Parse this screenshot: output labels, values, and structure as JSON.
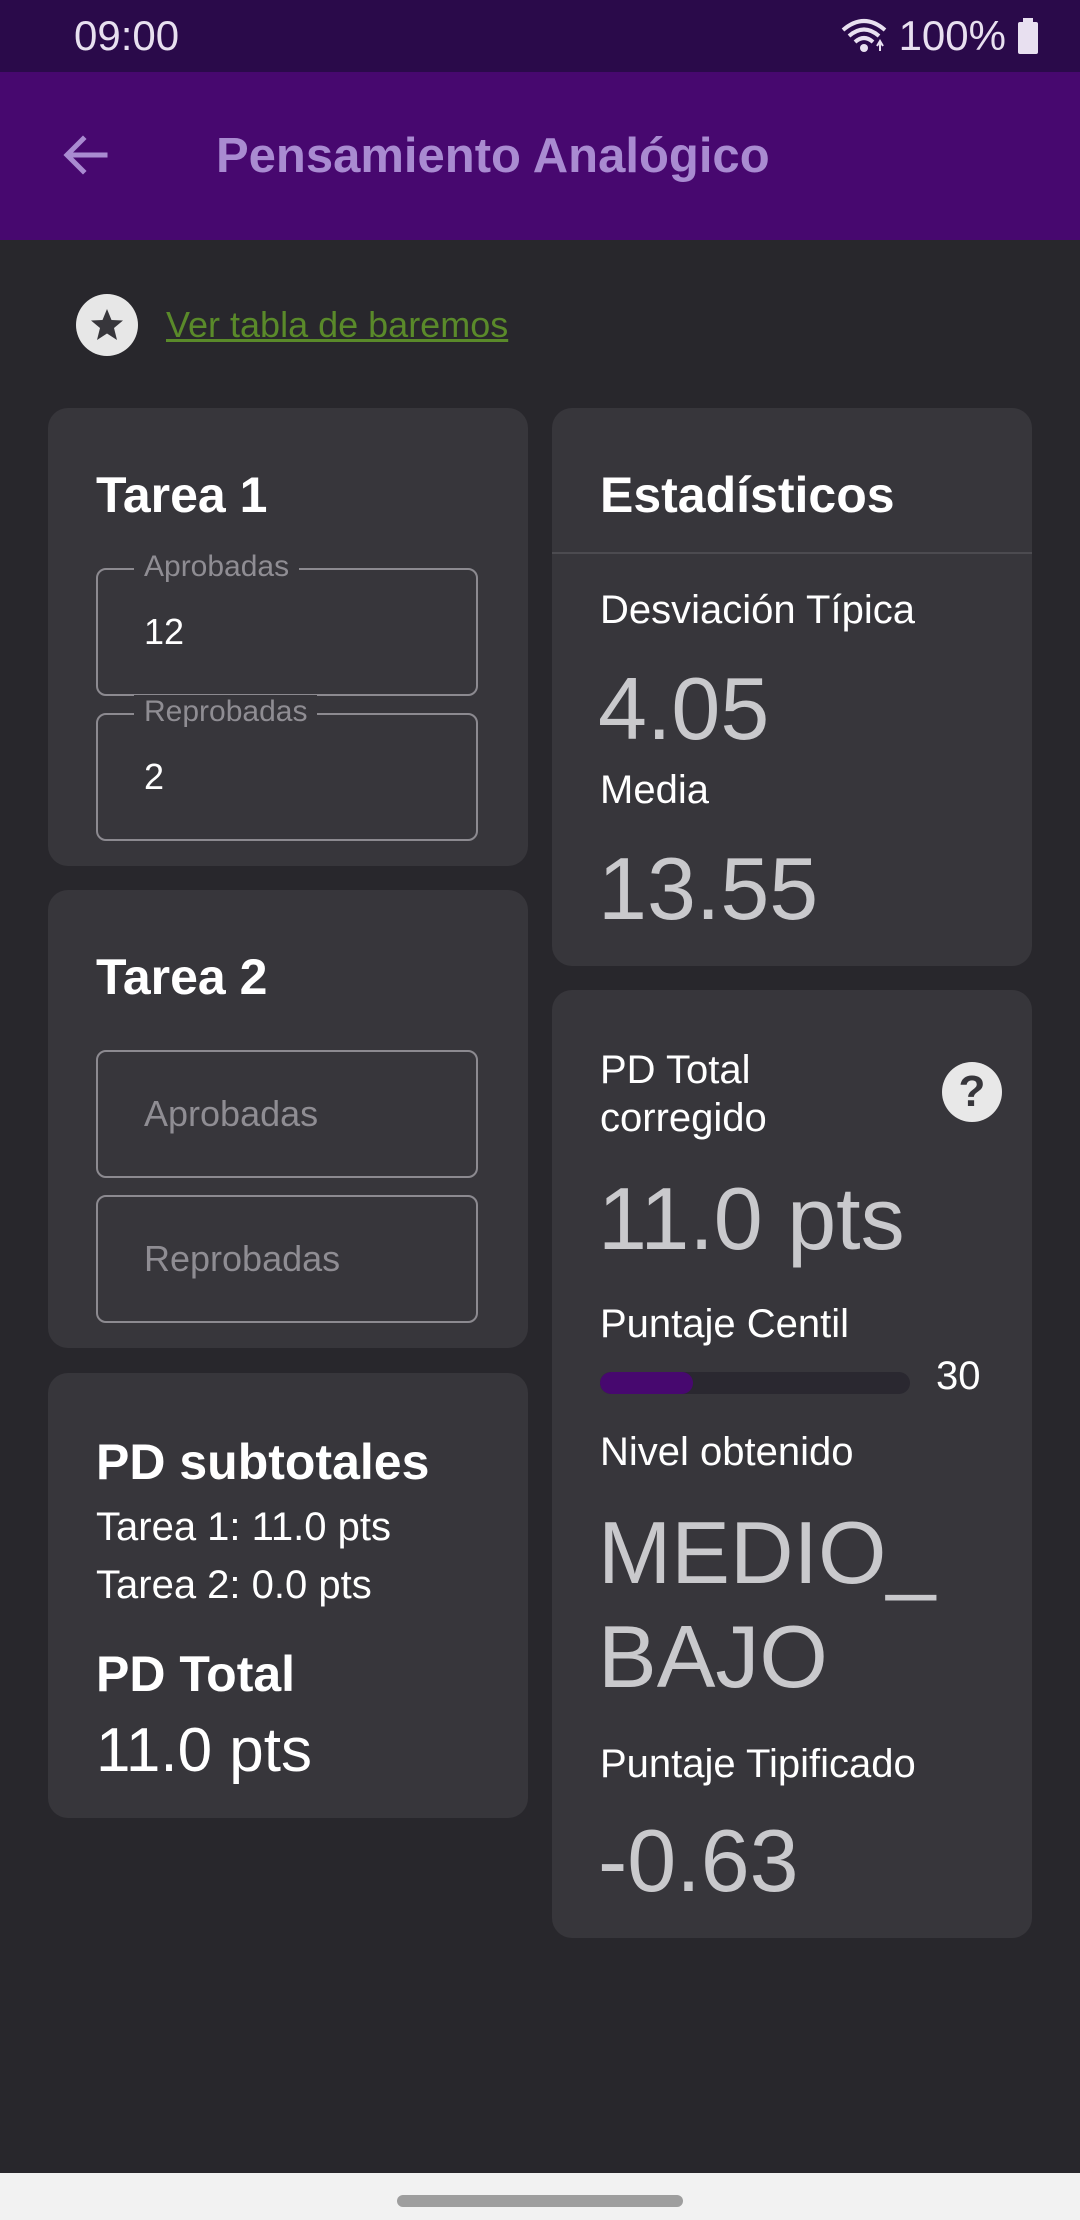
{
  "status_bar": {
    "time": "09:00",
    "battery": "100%"
  },
  "app_bar": {
    "title": "Pensamiento Analógico",
    "back_icon": "arrow-back-icon"
  },
  "baremos": {
    "icon": "star-circle-icon",
    "link_text": "Ver tabla de baremos",
    "link_color": "#5a8a2a"
  },
  "tarea1": {
    "title": "Tarea 1",
    "aprobadas_label": "Aprobadas",
    "aprobadas_value": "12",
    "reprobadas_label": "Reprobadas",
    "reprobadas_value": "2"
  },
  "tarea2": {
    "title": "Tarea 2",
    "aprobadas_placeholder": "Aprobadas",
    "reprobadas_placeholder": "Reprobadas"
  },
  "subtotales": {
    "title": "PD subtotales",
    "tarea1_line": "Tarea 1: 11.0 pts",
    "tarea2_line": "Tarea 2: 0.0 pts",
    "total_title": "PD Total",
    "total_value": "11.0 pts"
  },
  "estadisticos": {
    "title": "Estadísticos",
    "desviacion_label": "Desviación Típica",
    "desviacion_value": "4.05",
    "media_label": "Media",
    "media_value": "13.55"
  },
  "resultados": {
    "pd_total_corregido_label": "PD Total corregido",
    "pd_total_corregido_value": "11.0 pts",
    "help_icon": "help-icon",
    "centil_label": "Puntaje Centil",
    "centil_value": "30",
    "centil_fraction": 0.3,
    "nivel_label": "Nivel obtenido",
    "nivel_line1": "MEDIO_",
    "nivel_line2": "BAJO",
    "tipificado_label": "Puntaje Tipificado",
    "tipificado_value": "-0.63"
  },
  "colors": {
    "app_bar": "#47086f",
    "status_bar": "#2a0a4a",
    "background": "#28272c",
    "card": "#37363b",
    "title_text": "#a98bd1",
    "progress": "#47086f"
  }
}
